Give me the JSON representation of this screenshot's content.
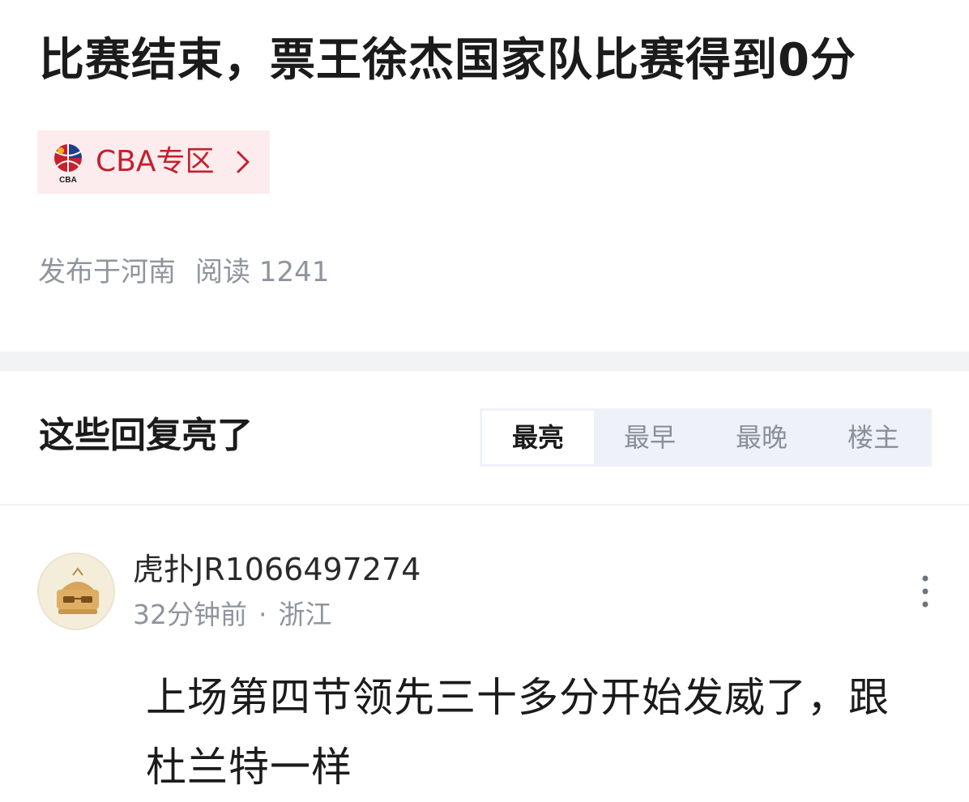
{
  "article": {
    "title": "比赛结束，票王徐杰国家队比赛得到0分",
    "topic_tag": {
      "label": "CBA专区",
      "logo_icon": "cba-logo-icon",
      "chevron_icon": "chevron-right-icon",
      "color": "#c3202f"
    },
    "location": "发布于河南",
    "reads": "阅读 1241"
  },
  "replies_section": {
    "title": "这些回复亮了",
    "sort_tabs": [
      {
        "label": "最亮",
        "active": true
      },
      {
        "label": "最早",
        "active": false
      },
      {
        "label": "最晚",
        "active": false
      },
      {
        "label": "楼主",
        "active": false
      }
    ]
  },
  "reply": {
    "avatar_icon": "avatar-icon",
    "username": "虎扑JR1066497274",
    "time": "32分钟前",
    "separator": "·",
    "location": "浙江",
    "more_icon": "more-vertical-icon",
    "body": "上场第四节领先三十多分开始发威了，跟杜兰特一样"
  }
}
